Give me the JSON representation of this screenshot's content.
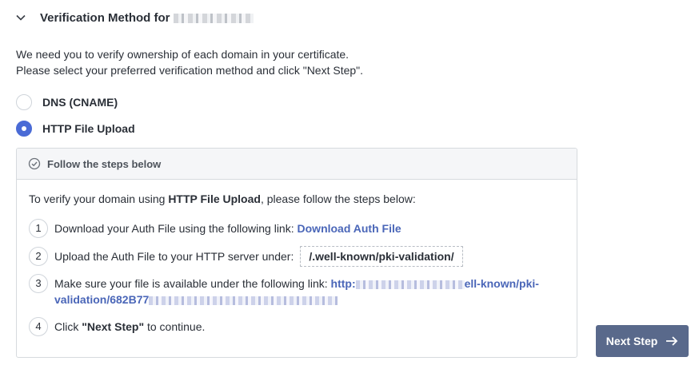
{
  "section": {
    "title": "Verification Method for"
  },
  "intro": {
    "line1": "We need you to verify ownership of each domain in your certificate.",
    "line2": "Please select your preferred verification method and click \"Next Step\"."
  },
  "methods": [
    {
      "label": "DNS (CNAME)",
      "selected": false
    },
    {
      "label": "HTTP File Upload",
      "selected": true
    }
  ],
  "panel": {
    "title": "Follow the steps below",
    "lead_before": "To verify your domain using ",
    "lead_bold": "HTTP File Upload",
    "lead_after": ", please follow the steps below:",
    "steps": [
      {
        "num": "1",
        "text": "Download your Auth File using the following link: ",
        "link": "Download Auth File"
      },
      {
        "num": "2",
        "text": "Upload the Auth File to your HTTP server under:",
        "path": "/.well-known/pki-validation/"
      },
      {
        "num": "3",
        "text": "Make sure your file is available under the following link: ",
        "link_a": "http:",
        "link_b": "ell-known/pki-",
        "link_c": "validation/682B77"
      },
      {
        "num": "4",
        "text_before": "Click ",
        "text_bold": "\"Next Step\"",
        "text_after": " to continue."
      }
    ]
  },
  "actions": {
    "next_label": "Next Step"
  },
  "colors": {
    "accent": "#4a6bd6",
    "link": "#4a66b8",
    "button": "#59698b"
  }
}
